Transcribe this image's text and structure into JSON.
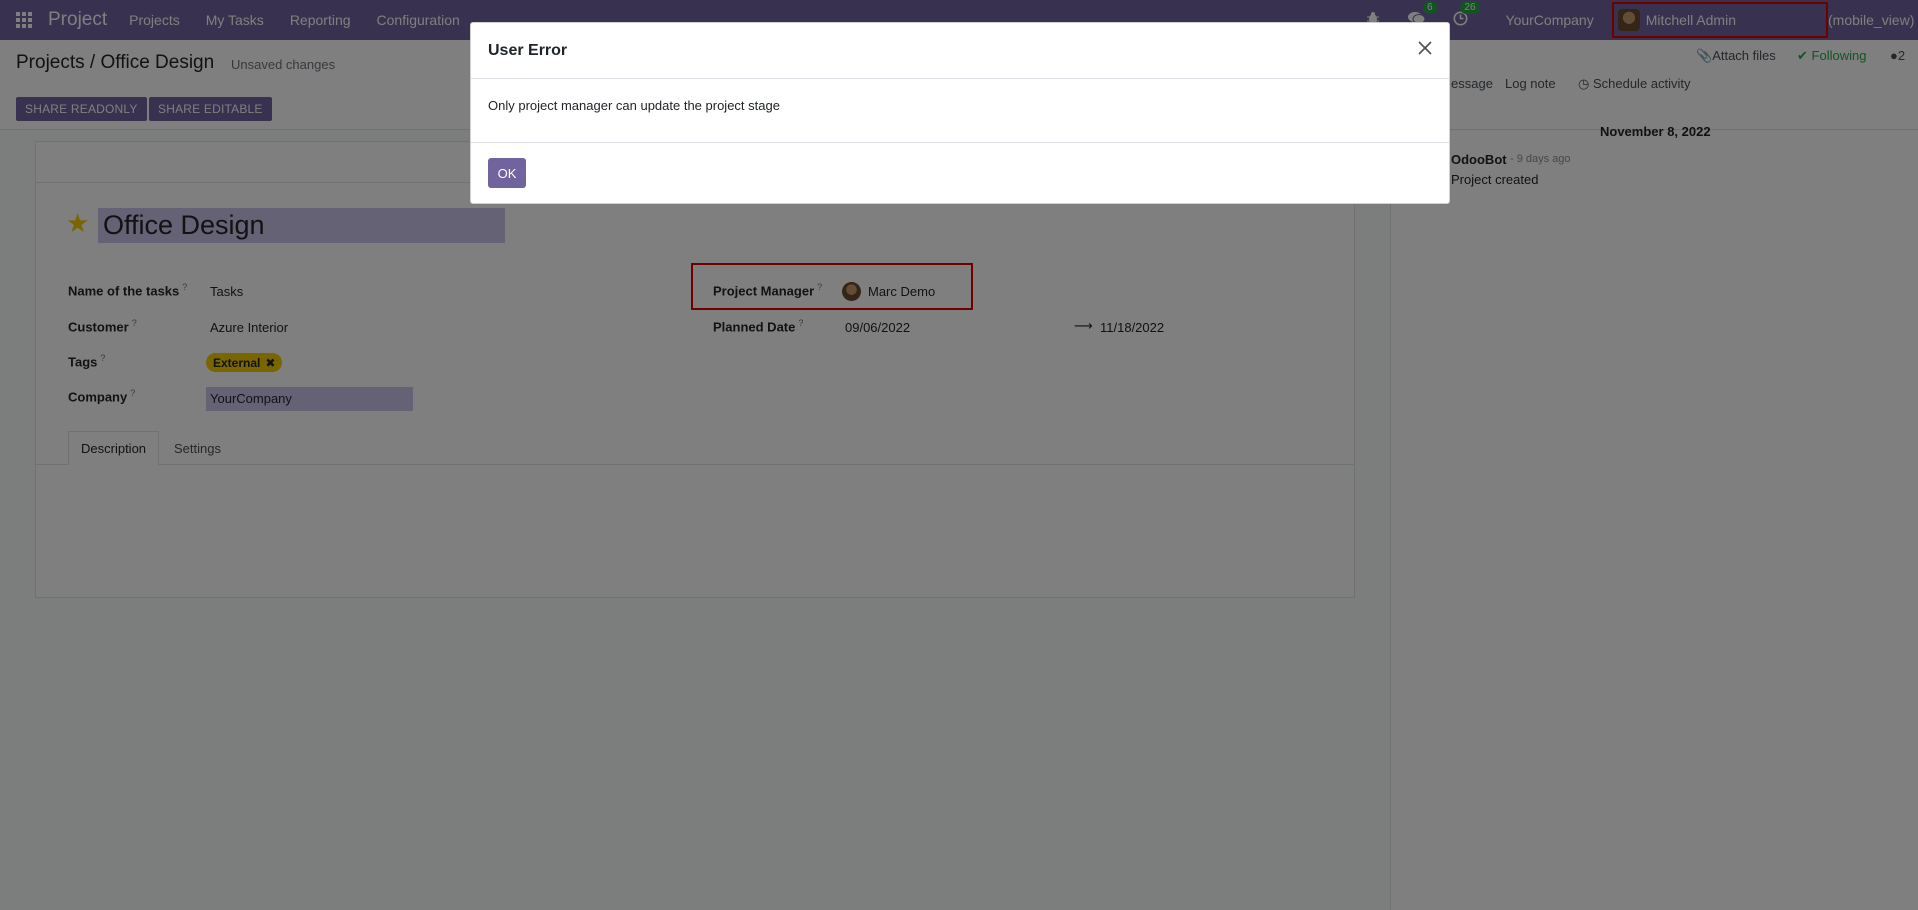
{
  "navbar": {
    "app_name": "Project",
    "menu": [
      "Projects",
      "My Tasks",
      "Reporting",
      "Configuration"
    ],
    "messages_count": "6",
    "activities_count": "26",
    "company": "YourCompany",
    "user_name": "Mitchell Admin",
    "user_suffix": "(mobile_view)"
  },
  "control_panel": {
    "breadcrumb_parent": "Projects",
    "breadcrumb_sep": "/",
    "breadcrumb_current": "Office Design",
    "unsaved": "Unsaved changes",
    "share_readonly": "SHARE READONLY",
    "share_editable": "SHARE EDITABLE"
  },
  "chatter": {
    "attach_files": "Attach files",
    "following": "Following",
    "followers_count": "2",
    "send_message": "essage",
    "log_note": "Log note",
    "schedule_activity": "Schedule activity",
    "date": "November 8, 2022",
    "author": "OdooBot",
    "time": "- 9 days ago",
    "body": "Project created"
  },
  "form": {
    "title": "Office Design",
    "name_of_tasks_label": "Name of the tasks",
    "name_of_tasks_value": "Tasks",
    "customer_label": "Customer",
    "customer_value": "Azure Interior",
    "tags_label": "Tags",
    "tag_value": "External",
    "company_label": "Company",
    "company_value": "YourCompany",
    "project_manager_label": "Project Manager",
    "project_manager_value": "Marc Demo",
    "planned_date_label": "Planned Date",
    "planned_start": "09/06/2022",
    "planned_end": "11/18/2022",
    "help_mark": "?",
    "tabs": [
      "Description",
      "Settings"
    ]
  },
  "dialog": {
    "title": "User Error",
    "message": "Only project manager can update the project stage",
    "ok_label": "OK"
  },
  "colors": {
    "brand": "#71639e",
    "highlight_border": "#e10000",
    "tag": "#f3cc00",
    "success": "#28a745"
  }
}
